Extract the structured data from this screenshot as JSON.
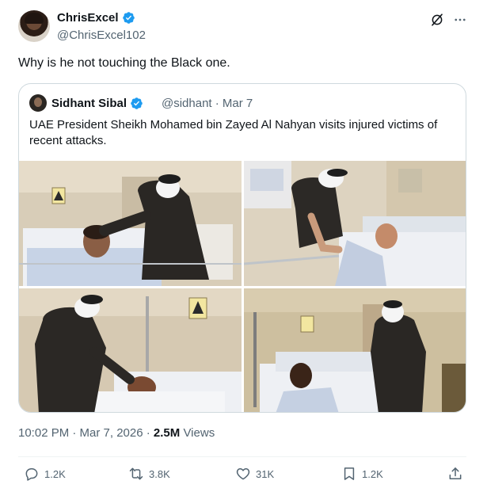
{
  "author": {
    "name": "ChrisExcel",
    "handle": "@ChrisExcel102",
    "verified": true
  },
  "tweet": {
    "text": "Why is he not touching the Black one."
  },
  "quoted": {
    "name": "Sidhant Sibal",
    "handle": "@sidhant",
    "date": "Mar 7",
    "meta": "@sidhant · Mar 7",
    "text": "UAE President Sheikh Mohamed bin Zayed Al Nahyan visits injured victims of recent attacks.",
    "photos": [
      {
        "alt": "visit-photo-1"
      },
      {
        "alt": "visit-photo-2"
      },
      {
        "alt": "visit-photo-3"
      },
      {
        "alt": "visit-photo-4"
      }
    ]
  },
  "meta": {
    "time": "10:02 PM · Mar 7, 2026 · ",
    "views_count": "2.5M",
    "views_label": " Views"
  },
  "actions": {
    "replies": "1.2K",
    "reposts": "3.8K",
    "likes": "31K",
    "bookmarks": "1.2K"
  },
  "colors": {
    "verified_blue": "#1d9bf0",
    "muted": "#536471",
    "text": "#0f1419",
    "border": "#cfd9de"
  }
}
